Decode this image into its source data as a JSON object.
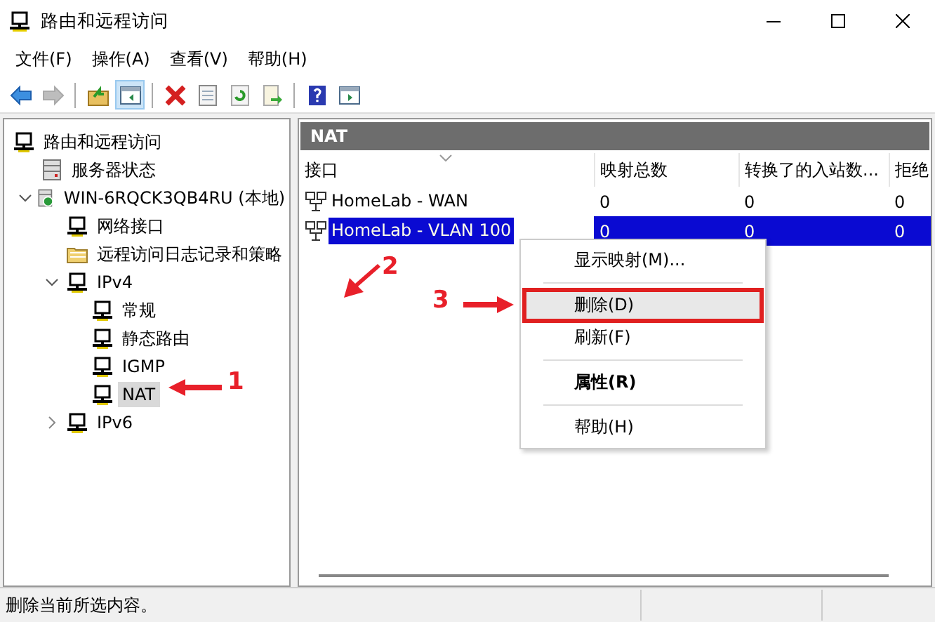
{
  "window": {
    "title": "路由和远程访问"
  },
  "menu_bar": [
    "文件(F)",
    "操作(A)",
    "查看(V)",
    "帮助(H)"
  ],
  "toolbar": [
    {
      "kind": "back",
      "disabled": false,
      "pressed": false
    },
    {
      "kind": "forward",
      "disabled": true,
      "pressed": false
    },
    {
      "kind": "sep"
    },
    {
      "kind": "up",
      "disabled": false,
      "pressed": false
    },
    {
      "kind": "pane",
      "disabled": false,
      "pressed": true
    },
    {
      "kind": "sep"
    },
    {
      "kind": "delete",
      "disabled": false,
      "pressed": false
    },
    {
      "kind": "properties",
      "disabled": false,
      "pressed": false
    },
    {
      "kind": "refresh",
      "disabled": false,
      "pressed": false
    },
    {
      "kind": "export",
      "disabled": false,
      "pressed": false
    },
    {
      "kind": "sep"
    },
    {
      "kind": "help",
      "disabled": false,
      "pressed": false
    },
    {
      "kind": "pane2",
      "disabled": false,
      "pressed": false
    }
  ],
  "tree": [
    {
      "label": "路由和远程访问",
      "kind": "network",
      "selected": false,
      "children": [
        {
          "label": "服务器状态",
          "kind": "server",
          "selected": false
        },
        {
          "label": "WIN-6RQCK3QB4RU (本地)",
          "kind": "host",
          "selected": false,
          "expanded": true,
          "children": [
            {
              "label": "网络接口",
              "kind": "network",
              "selected": false
            },
            {
              "label": "远程访问日志记录和策略",
              "kind": "folder",
              "selected": false
            },
            {
              "label": "IPv4",
              "kind": "network",
              "selected": false,
              "expanded": true,
              "children": [
                {
                  "label": "常规",
                  "kind": "network",
                  "selected": false
                },
                {
                  "label": "静态路由",
                  "kind": "network",
                  "selected": false
                },
                {
                  "label": "IGMP",
                  "kind": "network",
                  "selected": false
                },
                {
                  "label": "NAT",
                  "kind": "network",
                  "selected": true
                }
              ]
            },
            {
              "label": "IPv6",
              "kind": "network",
              "selected": false,
              "expanded": false
            }
          ]
        }
      ]
    }
  ],
  "detail": {
    "title": "NAT",
    "columns": [
      "接口",
      "映射总数",
      "转换了的入站数...",
      "拒绝"
    ],
    "rows": [
      {
        "cells": [
          "HomeLab - WAN",
          "0",
          "0",
          "0"
        ],
        "selected": false
      },
      {
        "cells": [
          "HomeLab - VLAN 100",
          "0",
          "0",
          "0"
        ],
        "selected": true
      }
    ]
  },
  "context_menu": [
    {
      "kind": "item",
      "label": "显示映射(M)...",
      "highlighted": false,
      "bold": false
    },
    {
      "kind": "sep"
    },
    {
      "kind": "item",
      "label": "删除(D)",
      "highlighted": true,
      "bold": false,
      "boxed": true
    },
    {
      "kind": "item",
      "label": "刷新(F)",
      "highlighted": false,
      "bold": false
    },
    {
      "kind": "sep"
    },
    {
      "kind": "item",
      "label": "属性(R)",
      "highlighted": false,
      "bold": true
    },
    {
      "kind": "sep"
    },
    {
      "kind": "item",
      "label": "帮助(H)",
      "highlighted": false,
      "bold": false
    }
  ],
  "annotations": [
    {
      "label": "1"
    },
    {
      "label": "2"
    },
    {
      "label": "3"
    }
  ],
  "status_bar": {
    "text": "删除当前所选内容。"
  }
}
